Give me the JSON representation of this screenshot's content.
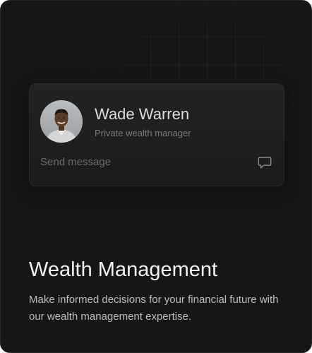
{
  "contact": {
    "name": "Wade Warren",
    "role": "Private wealth manager",
    "send_label": "Send message",
    "avatar_icon": "person-avatar",
    "message_icon": "chat-bubble-icon"
  },
  "feature": {
    "title": "Wealth Management",
    "description": "Make informed decisions for your financial future with our wealth management expertise."
  },
  "colors": {
    "card_background": "#161616",
    "contact_card_background": "#1f1f1f",
    "title_text": "#f3f3f3",
    "body_text": "#bdbdbd",
    "muted_text": "#6c6c6c"
  }
}
